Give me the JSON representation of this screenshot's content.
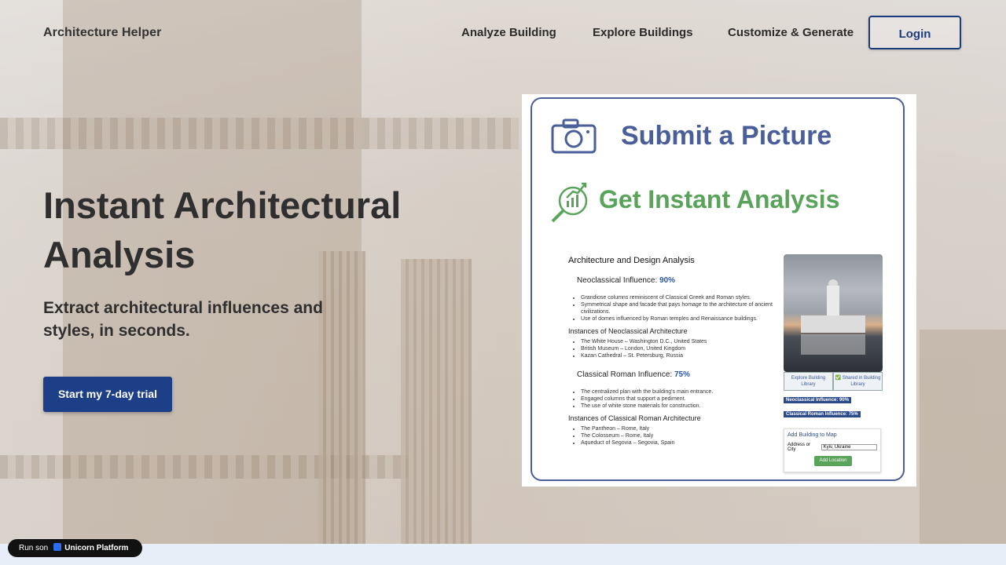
{
  "nav": {
    "brand": "Architecture Helper",
    "links": [
      "Analyze Building",
      "Explore Buildings",
      "Customize & Generate"
    ],
    "login": "Login"
  },
  "hero": {
    "headline": "Instant Architectural Analysis",
    "subhead": "Extract architectural influences and styles, in seconds.",
    "cta": "Start my 7-day trial"
  },
  "card": {
    "submit": "Submit a Picture",
    "instant": "Get Instant Analysis",
    "doc_title": "Architecture and Design Analysis",
    "neo_label": "Neoclassical Influence:",
    "neo_pct": "90%",
    "neo_points": [
      "Grandiose columns reminiscent of Classical Greek and Roman styles.",
      "Symmetrical shape and facade that pays homage to the architecture of ancient civilizations.",
      "Use of domes influenced by Roman temples and Renaissance buildings."
    ],
    "neo_instances_title": "Instances of Neoclassical Architecture",
    "neo_instances": [
      "The White House – Washington D.C., United States",
      "British Museum – London, United Kingdom",
      "Kazan Cathedral – St. Petersburg, Russia"
    ],
    "roman_label": "Classical Roman Influence:",
    "roman_pct": "75%",
    "roman_points": [
      "The centralized plan with the building's main entrance.",
      "Engaged columns that support a pediment.",
      "The use of white stone materials for construction."
    ],
    "roman_instances_title": "Instances of Classical Roman Architecture",
    "roman_instances": [
      "The Pantheon – Rome, Italy",
      "The Colosseum – Rome, Italy",
      "Aqueduct of Segovia – Segovia, Spain"
    ],
    "btn_explore": "Explore Building Library",
    "btn_shared": "✅ Shared in Building Library",
    "badge_neo": "Neoclassical Influence: 90%",
    "badge_roman": "Classical Roman Influence: 75%",
    "map_title": "Add Building to Map",
    "addr_label": "Address or City",
    "addr_value": "Kyiv, Ukraine",
    "add_btn": "Add Location"
  },
  "footer_badge": {
    "prefix": "Run son",
    "name": "Unicorn Platform"
  }
}
